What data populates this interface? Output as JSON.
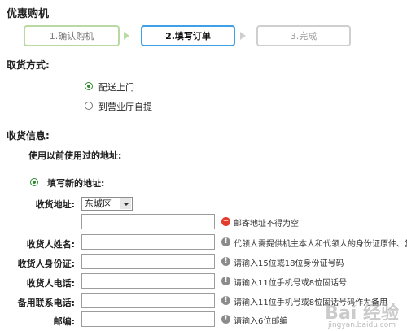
{
  "title": "优惠购机",
  "steps": [
    "1.确认购机",
    "2.填写订单",
    "3.完成"
  ],
  "delivery": {
    "label": "取货方式:",
    "options": [
      {
        "label": "配送上门",
        "selected": true
      },
      {
        "label": "到营业厅自提",
        "selected": false
      }
    ]
  },
  "receiver_info": {
    "label": "收货信息:",
    "used_address_label": "使用以前使用过的地址:",
    "new_address_label": "填写新的地址:",
    "address": {
      "label": "收货地址:",
      "select_value": "东城区",
      "error_text": "邮寄地址不得为空"
    },
    "fields": [
      {
        "label": "收货人姓名:",
        "hint": "代领人需提供机主本人和代领人的身份证原件、复"
      },
      {
        "label": "收货人身份证:",
        "hint": "请输入15位或18位身份证号码"
      },
      {
        "label": "收货人电话:",
        "hint": "请输入11位手机号或8位固话号"
      },
      {
        "label": "备用联系电话:",
        "hint": "请输入11位手机号或8位固话号码作为备用"
      },
      {
        "label": "邮编:",
        "hint": "请输入6位邮编"
      }
    ]
  },
  "watermark": {
    "main": "Bai 经验",
    "sub": "jingyan.baidu.com"
  }
}
